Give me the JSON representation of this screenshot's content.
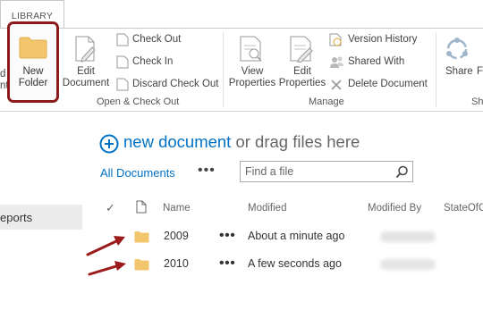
{
  "ribbon": {
    "tab": "LIBRARY",
    "partial_left": {
      "line1": "d",
      "line2": "nt"
    },
    "new_folder": {
      "line1": "New",
      "line2": "Folder"
    },
    "edit_document": {
      "line1": "Edit",
      "line2": "Document"
    },
    "check_out": "Check Out",
    "check_in": "Check In",
    "discard_check_out": "Discard Check Out",
    "group_open_checkout": "Open & Check Out",
    "view_properties": {
      "line1": "View",
      "line2": "Properties"
    },
    "edit_properties": {
      "line1": "Edit",
      "line2": "Properties"
    },
    "version_history": "Version History",
    "shared_with": "Shared With",
    "delete_document": "Delete Document",
    "group_manage": "Manage",
    "share": "Share",
    "partial_right": "F",
    "group_partial": "Sh"
  },
  "left_nav": {
    "item": "eports"
  },
  "main": {
    "new_document": "new document",
    "drag_text": " or drag files here",
    "view_name": "All Documents",
    "view_menu": "•••",
    "search_placeholder": "Find a file"
  },
  "columns": {
    "check": "✓",
    "name": "Name",
    "modified": "Modified",
    "modified_by": "Modified By",
    "state": "StateOfC"
  },
  "rows": [
    {
      "name": "2009",
      "menu": "•••",
      "modified": "About a minute ago"
    },
    {
      "name": "2010",
      "menu": "•••",
      "modified": "A few seconds ago"
    }
  ],
  "colors": {
    "accent": "#0072c6",
    "highlight": "#8b1a1a",
    "folder": "#f2c66d",
    "arrow": "#9b1b1b"
  }
}
